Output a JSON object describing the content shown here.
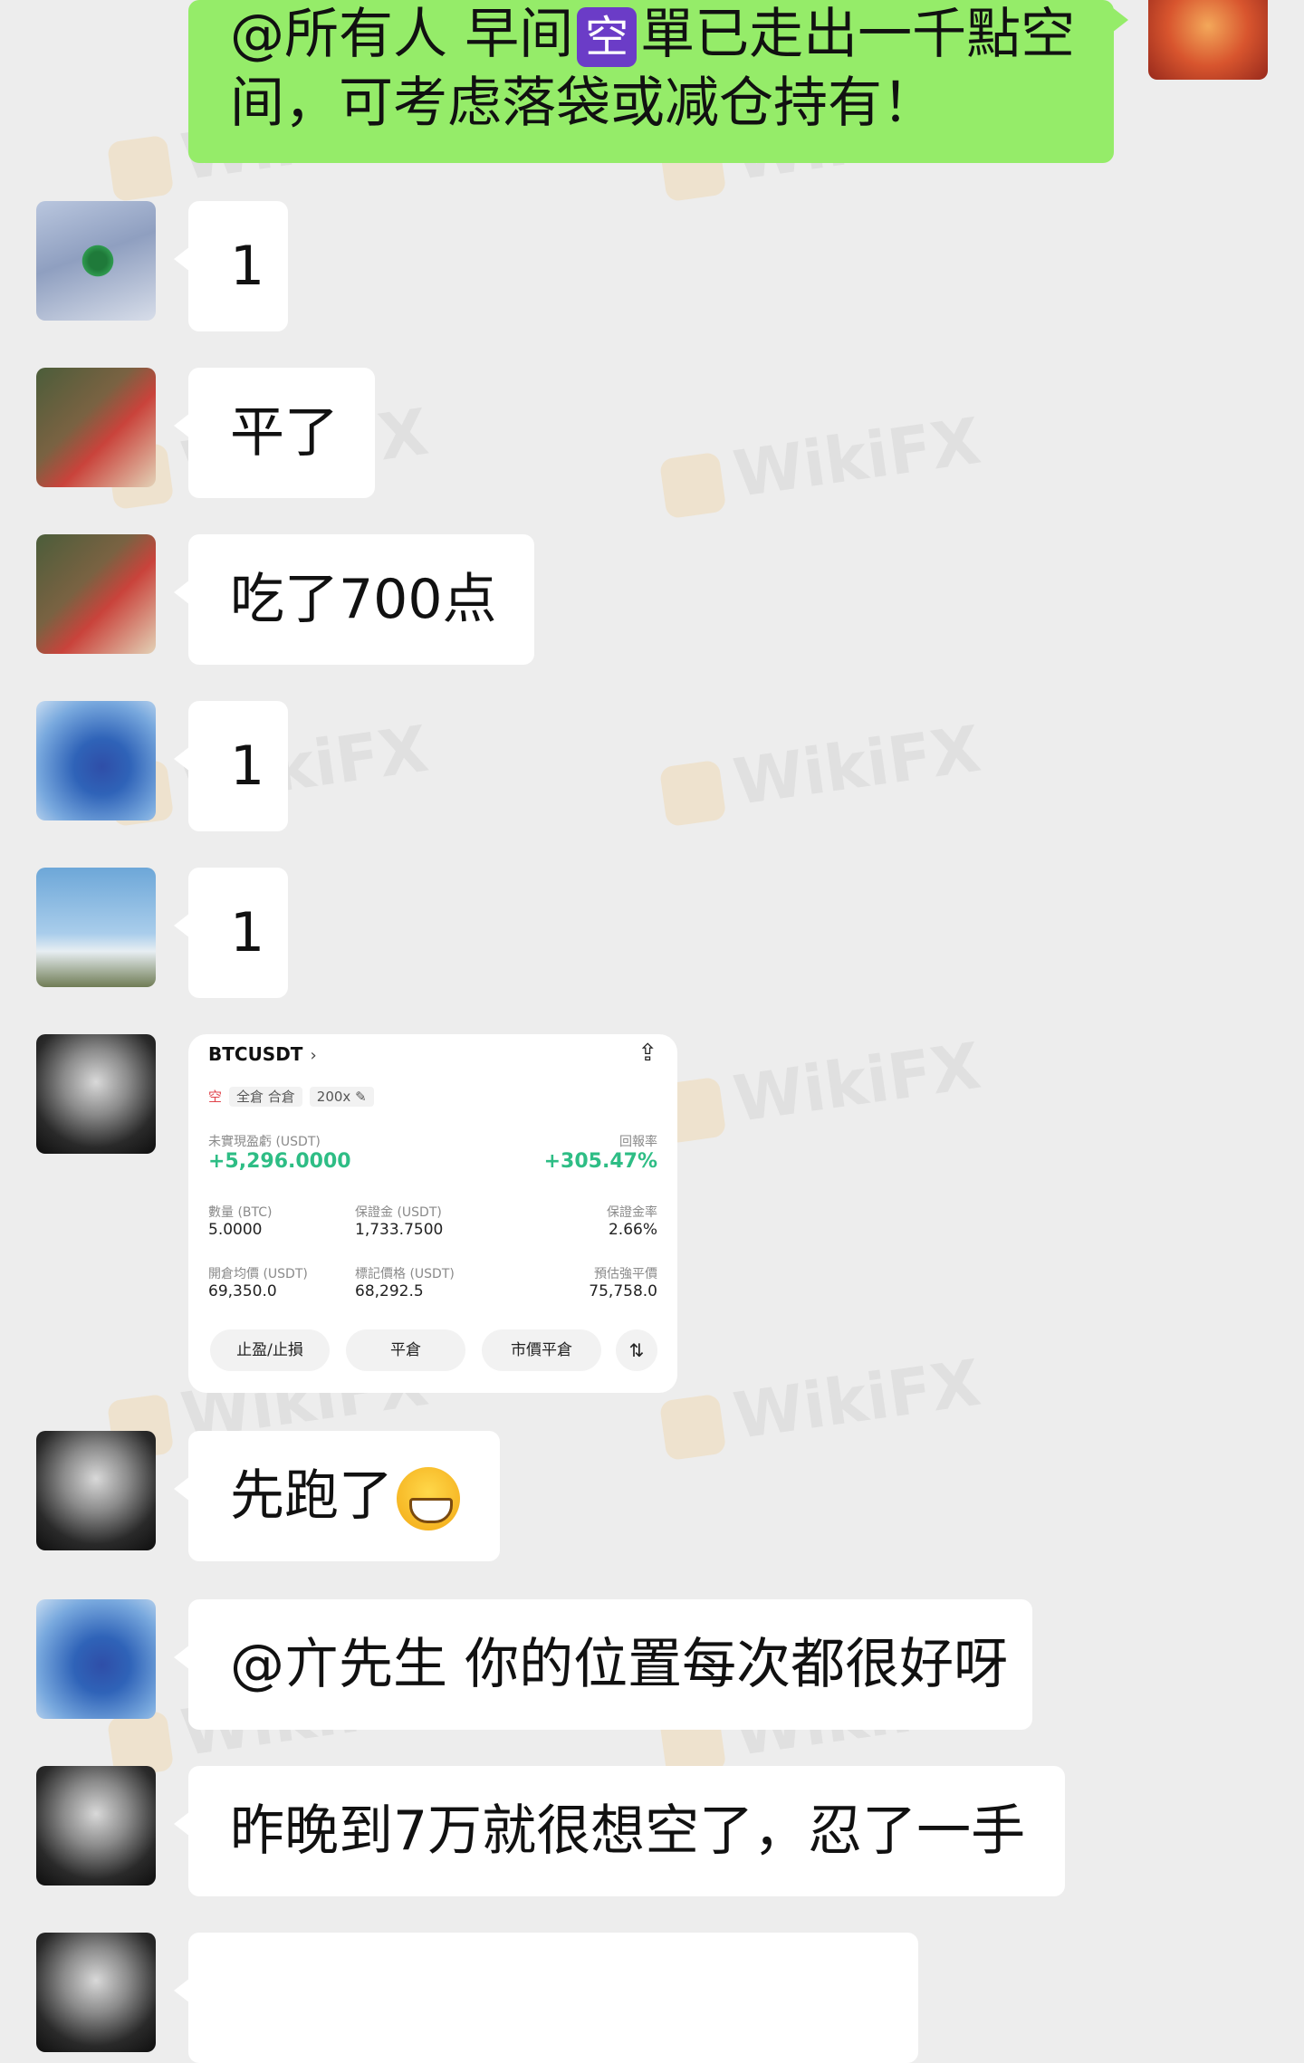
{
  "chat": {
    "announcement": {
      "before_icon": "@所有人 早间",
      "icon_char": "空",
      "after_icon": "單已走出一千點空间，可考虑落袋或减仓持有！"
    },
    "messages": [
      {
        "text": "1"
      },
      {
        "text": "平了"
      },
      {
        "text": "吃了700点"
      },
      {
        "text": "1"
      },
      {
        "text": "1"
      },
      {
        "text": "先跑了"
      },
      {
        "text": "@亣先生 你的位置每次都很好呀"
      },
      {
        "text": "昨晚到7万就很想空了，忍了一手"
      }
    ],
    "emoji": "grinning-face-emoji",
    "colors": {
      "outgoing_bubble": "#95ec69",
      "incoming_bubble": "#ffffff",
      "background": "#ededed",
      "profit": "#2ebd85",
      "short_tag": "#e0434b"
    }
  },
  "trade_card": {
    "pair": "BTCUSDT",
    "side": "空",
    "margin_mode": "全倉 合倉",
    "leverage": "200x",
    "unrealized_pnl_label": "未實現盈虧 (USDT)",
    "unrealized_pnl": "+5,296.0000",
    "roe_label": "回報率",
    "roe": "+305.47%",
    "qty_label": "數量 (BTC)",
    "qty": "5.0000",
    "margin_label": "保證金 (USDT)",
    "margin": "1,733.7500",
    "margin_ratio_label": "保證金率",
    "margin_ratio": "2.66%",
    "entry_label": "開倉均價 (USDT)",
    "entry": "69,350.0",
    "mark_label": "標記價格 (USDT)",
    "mark": "68,292.5",
    "liq_label": "預估強平價",
    "liq": "75,758.0",
    "buttons": [
      "止盈/止損",
      "平倉",
      "市價平倉"
    ],
    "icons": [
      "share-icon",
      "swap-icon",
      "edit-icon"
    ]
  },
  "watermark": "WikiFX"
}
